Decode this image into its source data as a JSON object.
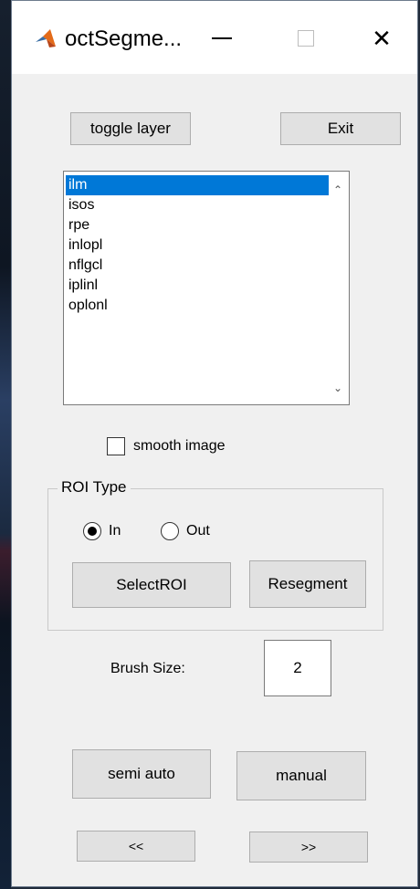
{
  "window": {
    "title": "octSegme...",
    "close_glyph": "✕"
  },
  "buttons": {
    "toggle_layer": "toggle layer",
    "exit": "Exit",
    "select_roi": "SelectROI",
    "resegment": "Resegment",
    "semi_auto": "semi auto",
    "manual": "manual",
    "prev": "<<",
    "next": ">>"
  },
  "layer_list": {
    "items": [
      "ilm",
      "isos",
      "rpe",
      "inlopl",
      "nflgcl",
      "iplinl",
      "oplonl"
    ],
    "selected": "ilm",
    "scroll_up_glyph": "⌃",
    "scroll_down_glyph": "⌄"
  },
  "smooth_image": {
    "label": "smooth image",
    "checked": false
  },
  "roi_type": {
    "title": "ROI Type",
    "options": [
      "In",
      "Out"
    ],
    "selected": "In"
  },
  "brush": {
    "label": "Brush Size:",
    "value": "2"
  },
  "colors": {
    "selection": "#0078d7",
    "button_face": "#e1e1e1",
    "window_bg": "#f0f0f0"
  },
  "icons": {
    "app": "matlab-icon",
    "minimize": "minimize-icon",
    "maximize": "maximize-icon",
    "close": "close-icon"
  }
}
